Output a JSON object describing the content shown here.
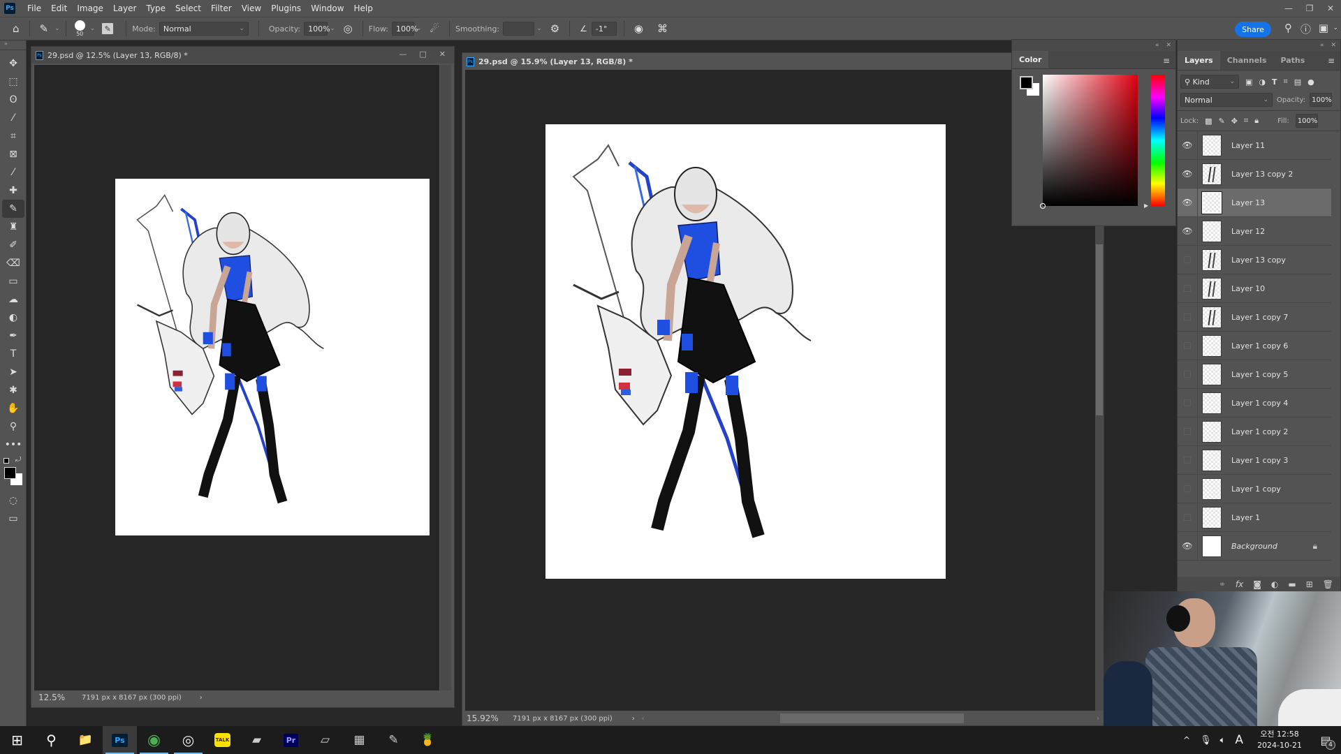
{
  "app": {
    "name": "Photoshop",
    "logo": "Ps"
  },
  "menu": [
    "File",
    "Edit",
    "Image",
    "Layer",
    "Type",
    "Select",
    "Filter",
    "View",
    "Plugins",
    "Window",
    "Help"
  ],
  "window_controls": {
    "minimize": "—",
    "restore": "❐",
    "close": "✕"
  },
  "options_bar": {
    "brush_size": "50",
    "mode_label": "Mode:",
    "mode_value": "Normal",
    "opacity_label": "Opacity:",
    "opacity_value": "100%",
    "flow_label": "Flow:",
    "flow_value": "100%",
    "smoothing_label": "Smoothing:",
    "smoothing_value": "",
    "angle_value": "-1°",
    "share_label": "Share"
  },
  "tools": [
    {
      "name": "move-tool",
      "glyph": "✥"
    },
    {
      "name": "marquee-tool",
      "glyph": "⬚"
    },
    {
      "name": "lasso-tool",
      "glyph": "ʘ"
    },
    {
      "name": "magic-wand-tool",
      "glyph": "⁄"
    },
    {
      "name": "crop-tool",
      "glyph": "⌗"
    },
    {
      "name": "frame-tool",
      "glyph": "⊠"
    },
    {
      "name": "eyedropper-tool",
      "glyph": "⁄"
    },
    {
      "name": "healing-brush-tool",
      "glyph": "✚"
    },
    {
      "name": "brush-tool",
      "glyph": "✎",
      "active": true
    },
    {
      "name": "clone-stamp-tool",
      "glyph": "♜"
    },
    {
      "name": "history-brush-tool",
      "glyph": "✐"
    },
    {
      "name": "eraser-tool",
      "glyph": "⌫"
    },
    {
      "name": "gradient-tool",
      "glyph": "▭"
    },
    {
      "name": "blur-tool",
      "glyph": "☁"
    },
    {
      "name": "dodge-tool",
      "glyph": "◐"
    },
    {
      "name": "pen-tool",
      "glyph": "✒"
    },
    {
      "name": "type-tool",
      "glyph": "T"
    },
    {
      "name": "path-selection-tool",
      "glyph": "➤"
    },
    {
      "name": "custom-shape-tool",
      "glyph": "✱"
    },
    {
      "name": "hand-tool",
      "glyph": "✋"
    },
    {
      "name": "zoom-tool",
      "glyph": "⚲"
    },
    {
      "name": "edit-toolbar",
      "glyph": "•••"
    }
  ],
  "documents": [
    {
      "title": "29.psd @ 12.5% (Layer 13, RGB/8) *",
      "zoom": "12.5%",
      "info": "7191 px x 8167 px (300 ppi)"
    },
    {
      "title": "29.psd @ 15.9% (Layer 13, RGB/8) *",
      "zoom": "15.92%",
      "info": "7191 px x 8167 px (300 ppi)"
    }
  ],
  "color_panel": {
    "tab": "Color",
    "foreground": "#000000",
    "background": "#ffffff",
    "hue": "#ff0000"
  },
  "layers_panel": {
    "tabs": [
      "Layers",
      "Channels",
      "Paths"
    ],
    "filter_label": "Kind",
    "blend_mode": "Normal",
    "opacity_label": "Opacity:",
    "opacity_value": "100%",
    "lock_label": "Lock:",
    "fill_label": "Fill:",
    "fill_value": "100%",
    "layers": [
      {
        "name": "Layer 11",
        "visible": true,
        "thumb": "blank"
      },
      {
        "name": "Layer 13 copy 2",
        "visible": true,
        "thumb": "figure"
      },
      {
        "name": "Layer 13",
        "visible": true,
        "thumb": "blank",
        "selected": true
      },
      {
        "name": "Layer 12",
        "visible": true,
        "thumb": "blank"
      },
      {
        "name": "Layer 13 copy",
        "visible": false,
        "thumb": "figure"
      },
      {
        "name": "Layer 10",
        "visible": false,
        "thumb": "figure"
      },
      {
        "name": "Layer 1 copy 7",
        "visible": false,
        "thumb": "figure"
      },
      {
        "name": "Layer 1 copy 6",
        "visible": false,
        "thumb": "blank"
      },
      {
        "name": "Layer 1 copy 5",
        "visible": false,
        "thumb": "blank"
      },
      {
        "name": "Layer 1 copy 4",
        "visible": false,
        "thumb": "blank"
      },
      {
        "name": "Layer 1 copy 2",
        "visible": false,
        "thumb": "blank"
      },
      {
        "name": "Layer 1 copy 3",
        "visible": false,
        "thumb": "blank"
      },
      {
        "name": "Layer 1 copy",
        "visible": false,
        "thumb": "blank"
      },
      {
        "name": "Layer 1",
        "visible": false,
        "thumb": "blank"
      },
      {
        "name": "Background",
        "visible": true,
        "thumb": "white",
        "locked": true
      }
    ],
    "footer_icons": [
      "link-layers-icon",
      "fx-icon",
      "mask-icon",
      "adjustment-icon",
      "group-icon",
      "new-layer-icon",
      "delete-icon"
    ]
  },
  "taskbar": {
    "apps": [
      {
        "name": "start",
        "glyph": "⊞"
      },
      {
        "name": "search",
        "glyph": "⚲"
      },
      {
        "name": "file-explorer",
        "glyph": "📁"
      },
      {
        "name": "photoshop",
        "glyph": "Ps",
        "active": true
      },
      {
        "name": "chrome",
        "glyph": "◉"
      },
      {
        "name": "obs",
        "glyph": "◎"
      },
      {
        "name": "kakaotalk",
        "glyph": "TALK"
      },
      {
        "name": "tablet-app",
        "glyph": "▰"
      },
      {
        "name": "premiere",
        "glyph": "Pr"
      },
      {
        "name": "notepad-app",
        "glyph": "▱"
      },
      {
        "name": "calculator",
        "glyph": "▦"
      },
      {
        "name": "notes",
        "glyph": "✎"
      },
      {
        "name": "misc-app",
        "glyph": "🍍"
      }
    ],
    "tray": {
      "ime": "A",
      "time": "오전 12:58",
      "date": "2024-10-21",
      "notifications": "4"
    }
  }
}
